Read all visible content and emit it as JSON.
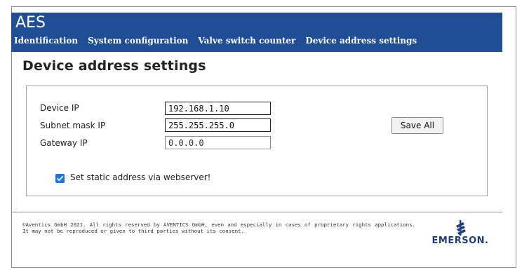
{
  "app": {
    "title": "AES"
  },
  "nav": {
    "items": [
      {
        "label": "Identification"
      },
      {
        "label": "System configuration"
      },
      {
        "label": "Valve switch counter"
      },
      {
        "label": "Device address settings"
      }
    ]
  },
  "page": {
    "title": "Device address settings"
  },
  "form": {
    "device_ip": {
      "label": "Device IP",
      "value": "192.168.1.10"
    },
    "subnet_mask": {
      "label": "Subnet mask IP",
      "value": "255.255.255.0"
    },
    "gateway_ip": {
      "label": "Gateway IP",
      "value": "0.0.0.0"
    },
    "save_label": "Save All",
    "static_checkbox": {
      "label": "Set static address via webserver!",
      "checked": true
    }
  },
  "footer": {
    "copyright": "©Aventics GmbH 2021. All rights reserved by AVENTICS GmbH, even and especially in cases of proprietary rights applications. It may not be reproduced or given to third parties without its consent.",
    "logo_text": "EMERSON.",
    "logo_icon": "emerson-logo-icon"
  },
  "colors": {
    "header_bg": "#1f4e96",
    "checkbox": "#1a73e8",
    "logo": "#1f3f7a"
  }
}
